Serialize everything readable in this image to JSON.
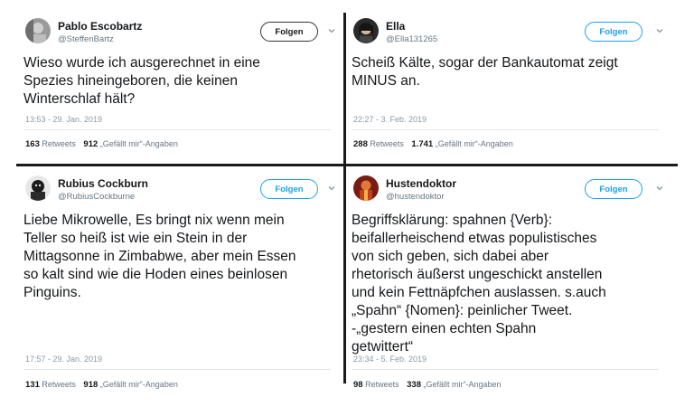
{
  "tweets": [
    {
      "name": "Pablo Escobartz",
      "handle": "@SteffenBartz",
      "follow_label": "Folgen",
      "text": "Wieso wurde ich ausgerechnet in eine\nSpezies hineingeboren, die keinen\nWinterschlaf hält?",
      "time": "13:53 - 29. Jan. 2019",
      "retweets": "163",
      "retweets_label": "Retweets",
      "likes": "912",
      "likes_label": "„Gefällt mir“-Angaben",
      "avatar_icon": "avatar-photo-gray"
    },
    {
      "name": "Ella",
      "handle": "@Ella131265",
      "follow_label": "Folgen",
      "text": "Scheiß Kälte, sogar der Bankautomat zeigt\nMINUS an.",
      "time": "22:27 - 3. Feb. 2019",
      "retweets": "288",
      "retweets_label": "Retweets",
      "likes": "1.741",
      "likes_label": "„Gefällt mir“-Angaben",
      "avatar_icon": "avatar-photo-dark"
    },
    {
      "name": "Rubius Cockburn",
      "handle": "@RubiusCockburne",
      "follow_label": "Folgen",
      "text": "Liebe Mikrowelle, Es bringt nix wenn mein\nTeller so heiß ist wie ein Stein in der\nMittagsonne in Zimbabwe, aber mein Essen\nso kalt sind wie die Hoden eines beinlosen\nPinguins.",
      "time": "17:57 - 29. Jan. 2019",
      "retweets": "131",
      "retweets_label": "Retweets",
      "likes": "918",
      "likes_label": "„Gefällt mir“-Angaben",
      "avatar_icon": "avatar-photo-bw"
    },
    {
      "name": "Hustendoktor",
      "handle": "@hustendoktor",
      "follow_label": "Folgen",
      "text": "Begriffsklärung: spahnen {Verb}:\nbeifallerheischend etwas populistisches\nvon sich geben, sich dabei aber\nrhetorisch äußerst ungeschickt anstellen\nund kein Fettnäpfchen auslassen. s.auch\n„Spahn“ {Nomen}: peinlicher Tweet.\n-„gestern einen echten Spahn\ngetwittert“",
      "time": "23:34 - 5. Feb. 2019",
      "retweets": "98",
      "retweets_label": "Retweets",
      "likes": "338",
      "likes_label": "„Gefällt mir“-Angaben",
      "avatar_icon": "avatar-photo-red"
    }
  ],
  "colors": {
    "accent": "#1da1f2",
    "text": "#14171a",
    "muted": "#657786",
    "divider": "#1a1a1a"
  }
}
